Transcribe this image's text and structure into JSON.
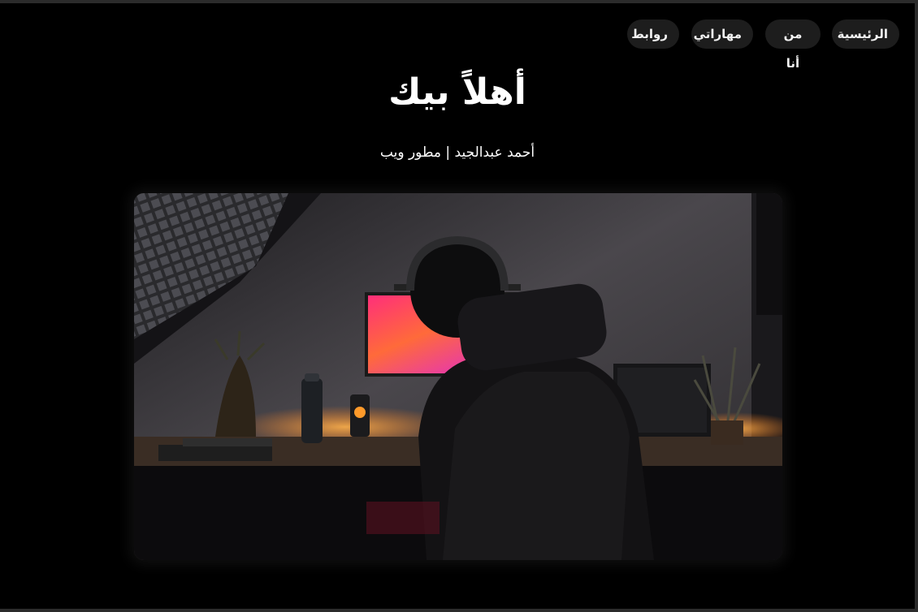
{
  "nav": {
    "items": [
      {
        "label": "الرئيسية"
      },
      {
        "label": "من أنا"
      },
      {
        "label": "مهاراتي"
      },
      {
        "label": "روابط"
      }
    ]
  },
  "hero": {
    "title": "أهلاً بيك",
    "subtitle": "أحمد عبدالجيد | مطور ويب",
    "image_alt": "شخص يرتدي سماعات أمام شاشة كمبيوتر في غرفة مظلمة"
  },
  "colors": {
    "background": "#000000",
    "nav_button": "#1d1d1d",
    "text": "#ffffff",
    "accent_glow": "#ff8a2a"
  }
}
